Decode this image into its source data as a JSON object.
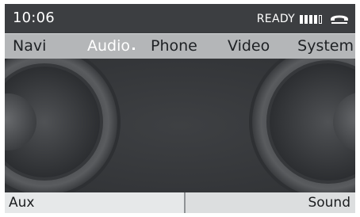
{
  "status": {
    "time": "10:06",
    "ready_text": "READY",
    "signal_level": 4,
    "signal_max": 5,
    "phone_icon": "phone-handset-icon"
  },
  "menu": {
    "items": [
      {
        "label": "Navi"
      },
      {
        "label": "Audio"
      },
      {
        "label": "Phone"
      },
      {
        "label": "Video"
      },
      {
        "label": "System"
      }
    ],
    "active_item": "Audio"
  },
  "main": {
    "background_icon": "speaker-graphic"
  },
  "bottom": {
    "left_label": "Aux",
    "right_label": "Sound"
  },
  "colors": {
    "screen_bg": "#3b3d40",
    "menu_bg": "#b4b6b8",
    "active_menu_text": "#ffffff",
    "menu_text": "#1e2124",
    "bottom_bg": "#dcdedf"
  }
}
